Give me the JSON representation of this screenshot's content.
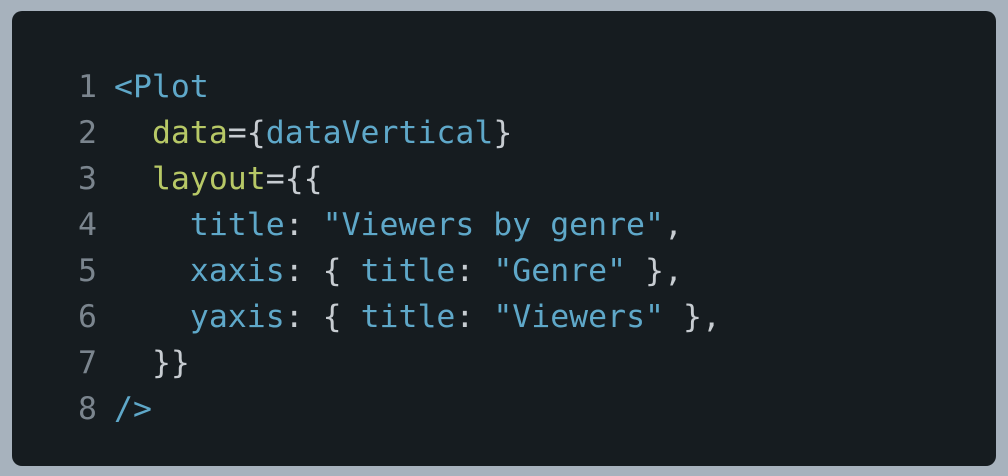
{
  "code": {
    "line_numbers": [
      "1",
      "2",
      "3",
      "4",
      "5",
      "6",
      "7",
      "8"
    ],
    "lines": [
      {
        "tag_open": "<Plot"
      },
      {
        "indent": "  ",
        "attr": "data",
        "eq": "={",
        "ident": "dataVertical",
        "close": "}"
      },
      {
        "indent": "  ",
        "attr": "layout",
        "eq": "={{"
      },
      {
        "indent": "    ",
        "key": "title",
        "colon": ": ",
        "string": "\"Viewers by genre\"",
        "comma": ","
      },
      {
        "indent": "    ",
        "key": "xaxis",
        "colon": ": ",
        "brace_open": "{ ",
        "inner_key": "title",
        "inner_colon": ": ",
        "string": "\"Genre\"",
        "brace_close": " }",
        "comma": ","
      },
      {
        "indent": "    ",
        "key": "yaxis",
        "colon": ": ",
        "brace_open": "{ ",
        "inner_key": "title",
        "inner_colon": ": ",
        "string": "\"Viewers\"",
        "brace_close": " }",
        "comma": ","
      },
      {
        "indent": "  ",
        "close": "}}"
      },
      {
        "tag_close": "/>"
      }
    ]
  },
  "colors": {
    "background": "#161c20",
    "frame": "#a7b2bd",
    "attribute": "#b7c866",
    "identifier": "#5fa8c9",
    "line_number": "#7b858e"
  }
}
